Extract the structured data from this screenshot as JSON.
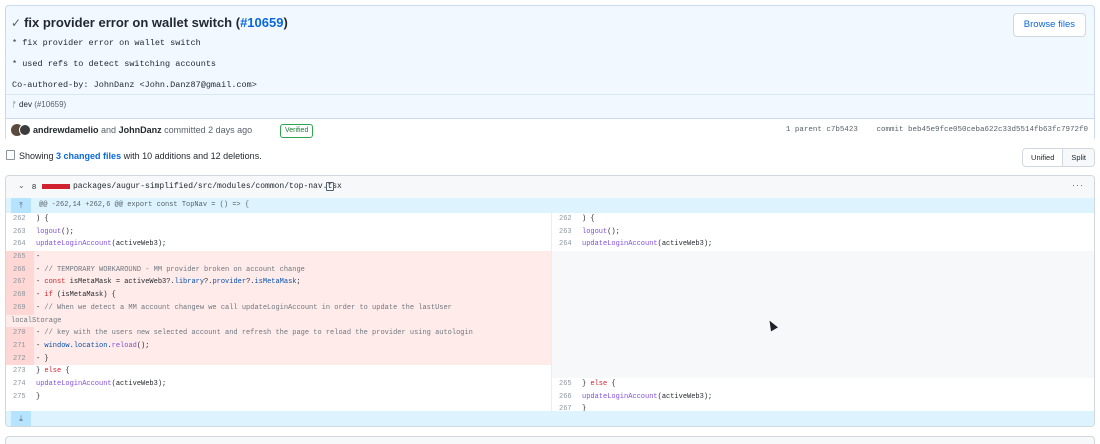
{
  "commit": {
    "title": "fix provider error on wallet switch",
    "pr_link": "#10659",
    "message_lines": [
      "* fix provider error on wallet switch",
      "* used refs to detect switching accounts",
      "Co-authored-by: JohnDanz <John.Danz87@gmail.com>"
    ],
    "browse_button": "Browse files",
    "branch": "dev",
    "branch_pr": "(#10659)",
    "author1": "andrewdamelio",
    "and_text": "and",
    "author2": "JohnDanz",
    "committed_text": "committed 2 days ago",
    "verified": "Verified",
    "parent_label": "1 parent c7b5423",
    "commit_label": "commit beb45e9fce050ceba622c33d5514fb63fc7972f0"
  },
  "summary": {
    "showing": "Showing",
    "changed_files": "3 changed files",
    "rest": "with 10 additions and 12 deletions.",
    "view_unified": "Unified",
    "view_split": "Split"
  },
  "file": {
    "change_count": "8",
    "path": "packages/augur-simplified/src/modules/common/top-nav.tsx",
    "hunk_header": "@@ -262,14 +262,6 @@ export const TopNav = () => {"
  },
  "colors": {
    "deletion_bg": "#ffebe9",
    "deletion_num_bg": "#ffd7d5",
    "hunk_bg": "#ddf4ff",
    "link": "#0969da",
    "verified_green": "#1a7f37"
  },
  "icons": {
    "check": "check-icon",
    "branch": "git-branch-icon",
    "file": "file-diff-icon",
    "chevron": "chevron-down-icon",
    "copy": "copy-icon",
    "kebab": "kebab-horizontal-icon",
    "expand_up": "expand-up-icon",
    "expand_down": "expand-down-icon"
  }
}
